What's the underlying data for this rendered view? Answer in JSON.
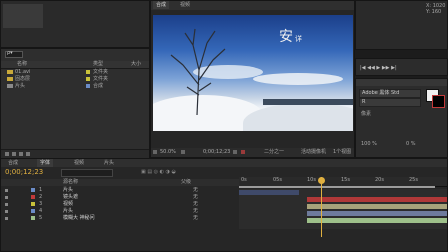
{
  "viewer": {
    "tab_label": "合成",
    "tab_label_2": "视频",
    "overlay_big": "安",
    "overlay_small": "详",
    "zoom": "50.0%",
    "timecode": "0;00;12;23",
    "quality": "二分之一",
    "camera": "活动摄像机",
    "views": "1个视图"
  },
  "info_panel": {
    "lines": [
      "X: 1020",
      "Y: 160"
    ]
  },
  "project": {
    "search_placeholder": "",
    "columns": [
      "名称",
      "类型",
      "大小"
    ],
    "items": [
      {
        "name": "01.avi",
        "type": "文件夹",
        "color": "#c9c23a"
      },
      {
        "name": "固态层",
        "type": "文件夹",
        "color": "#c9c23a"
      },
      {
        "name": "片头",
        "type": "合成",
        "color": "#6b8cc7"
      }
    ]
  },
  "right_panel": {
    "font_name": "Adobe 黑体 Std",
    "style": "R",
    "size_label": "像素",
    "percent_1": "100 %",
    "percent_2": "0 %"
  },
  "timeline": {
    "tabs": [
      "合成",
      "字体",
      "视频",
      "片头"
    ],
    "current_time": "0;00;12;23",
    "col_source": "源名称",
    "col_parent": "父级",
    "layers": [
      {
        "num": "1",
        "name": "片头",
        "parent": "无",
        "color": "#6b8cc7"
      },
      {
        "num": "2",
        "name": "镜头遮",
        "parent": "无",
        "color": "#c23a3a"
      },
      {
        "num": "3",
        "name": "视频",
        "parent": "无",
        "color": "#c9c23a"
      },
      {
        "num": "4",
        "name": "片头",
        "parent": "无",
        "color": "#6b8cc7"
      },
      {
        "num": "5",
        "name": "模糊大 神秘问",
        "parent": "无",
        "color": "#9ec08a"
      }
    ],
    "ruler_labels": [
      "0s",
      "05s",
      "10s",
      "15s",
      "20s",
      "25s"
    ]
  }
}
